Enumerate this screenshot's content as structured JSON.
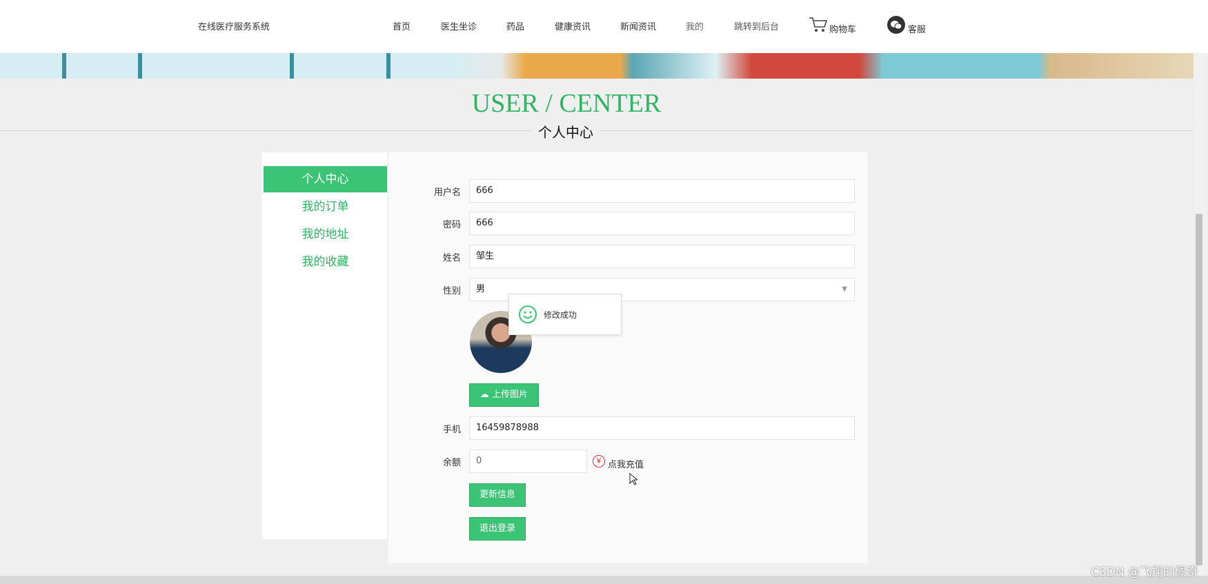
{
  "header": {
    "site_name": "在线医疗服务系统",
    "nav": [
      "首页",
      "医生坐诊",
      "药品",
      "健康资讯",
      "新闻资讯",
      "我的",
      "跳转到后台"
    ],
    "cart": "购物车",
    "service": "客服"
  },
  "page": {
    "title_en": "USER / CENTER",
    "title_cn": "个人中心"
  },
  "sidebar": {
    "items": [
      "个人中心",
      "我的订单",
      "我的地址",
      "我的收藏"
    ],
    "active": "个人中心"
  },
  "form": {
    "username": {
      "label": "用户名",
      "value": "666"
    },
    "password": {
      "label": "密码",
      "value": "666"
    },
    "name": {
      "label": "姓名",
      "value": "邹生"
    },
    "gender": {
      "label": "性别",
      "value": "男"
    },
    "upload_label": "上传图片",
    "phone": {
      "label": "手机",
      "value": "16459878988"
    },
    "balance": {
      "label": "余额",
      "value": "0",
      "recharge": "点我充值"
    },
    "update_label": "更新信息",
    "logout_label": "退出登录"
  },
  "toast": {
    "message": "修改成功",
    "icon": "smile-icon"
  },
  "watermark": "CSDN @飞翔的佩奇",
  "colors": {
    "accent": "#3cc476",
    "title": "#2fb463",
    "recharge_icon": "#d33"
  }
}
